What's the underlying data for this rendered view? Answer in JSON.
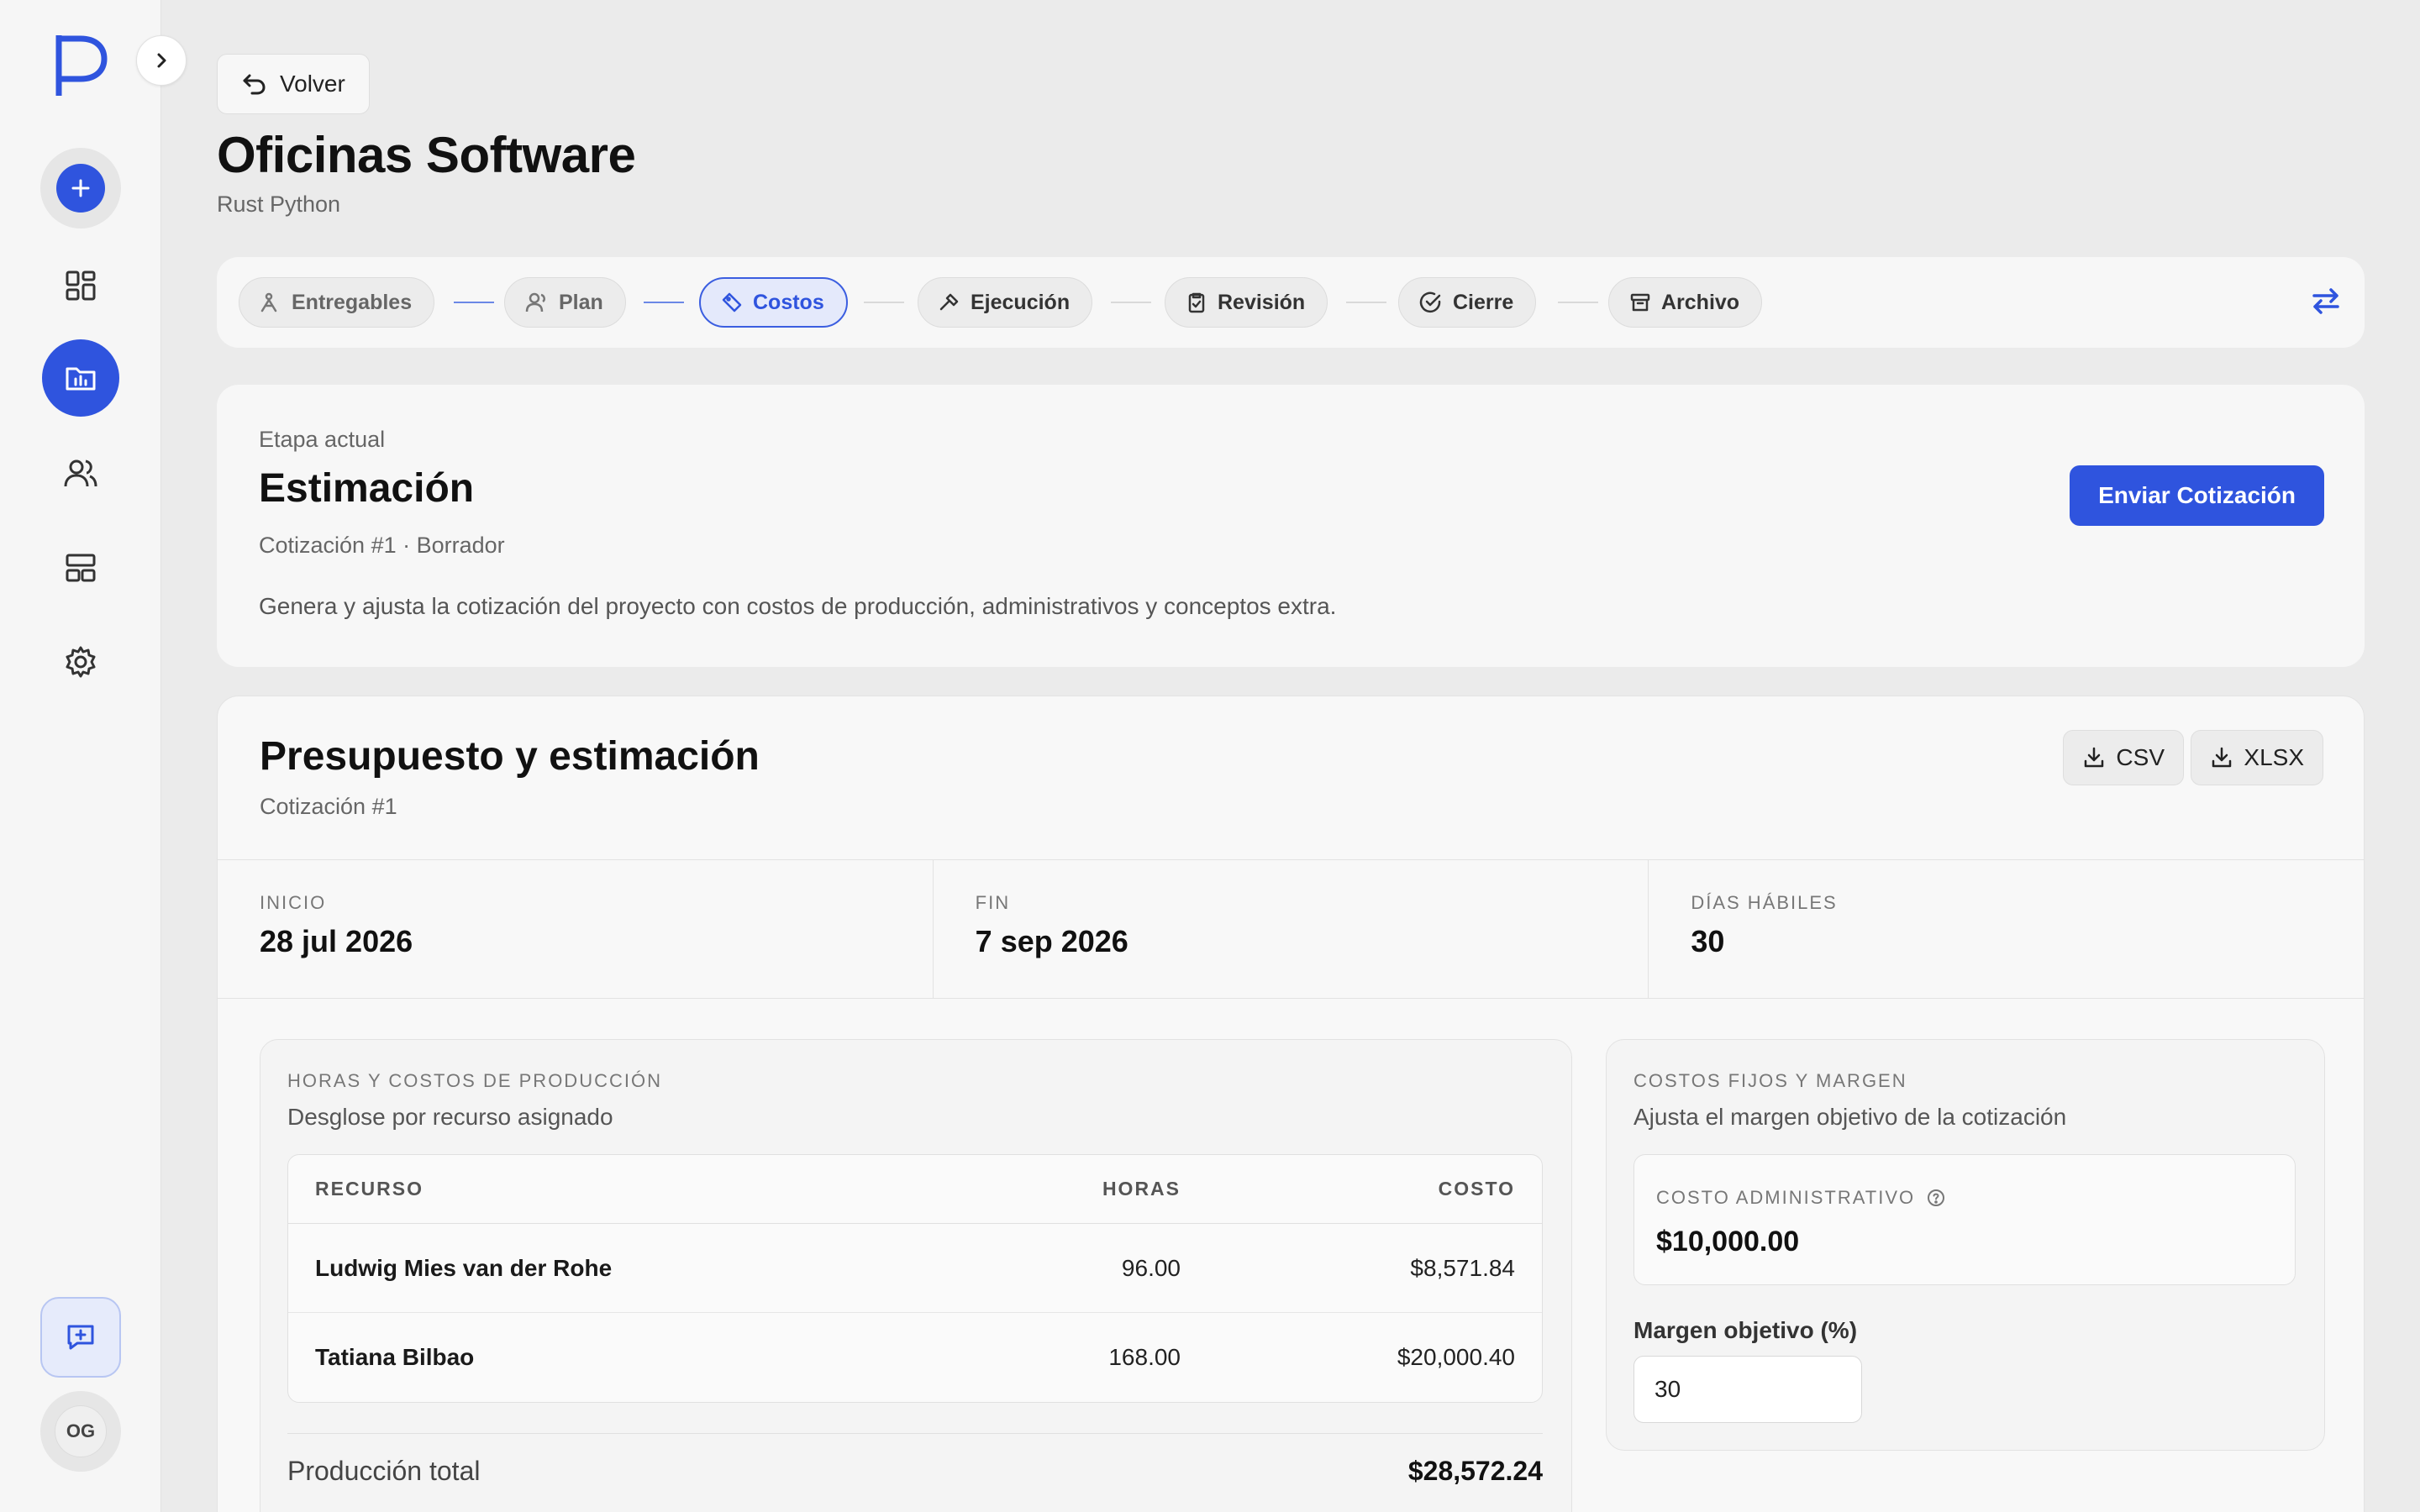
{
  "sidebar": {
    "logo_letter": "P",
    "avatar_initials": "OG",
    "icons": [
      "add-icon",
      "dashboard-icon",
      "projects-icon",
      "users-icon",
      "layout-icon",
      "settings-icon",
      "chat-icon"
    ],
    "accent": "#2f54de"
  },
  "header": {
    "back_label": "Volver",
    "title": "Oficinas Software",
    "subtitle": "Rust Python"
  },
  "stepper": {
    "steps": [
      {
        "label": "Entregables",
        "state": "done"
      },
      {
        "label": "Plan",
        "state": "done"
      },
      {
        "label": "Costos",
        "state": "active"
      },
      {
        "label": "Ejecución",
        "state": "todo"
      },
      {
        "label": "Revisión",
        "state": "todo"
      },
      {
        "label": "Cierre",
        "state": "todo"
      },
      {
        "label": "Archivo",
        "state": "todo"
      }
    ]
  },
  "stage": {
    "label": "Etapa actual",
    "title": "Estimación",
    "meta": "Cotización #1 · Borrador",
    "description": "Genera y ajusta la cotización del proyecto con costos de producción, administrativos y conceptos extra.",
    "send_label": "Enviar Cotización"
  },
  "budget": {
    "title": "Presupuesto y estimación",
    "subtitle": "Cotización #1",
    "export_csv": "CSV",
    "export_xlsx": "XLSX",
    "dates": [
      {
        "label": "INICIO",
        "value": "28 jul 2026"
      },
      {
        "label": "FIN",
        "value": "7 sep 2026"
      },
      {
        "label": "DÍAS HÁBILES",
        "value": "30"
      }
    ],
    "production": {
      "kicker": "HORAS Y COSTOS DE PRODUCCIÓN",
      "subtitle": "Desglose por recurso asignado",
      "columns": {
        "resource": "RECURSO",
        "hours": "HORAS",
        "cost": "COSTO"
      },
      "rows": [
        {
          "resource": "Ludwig Mies van der Rohe",
          "hours": "96.00",
          "cost": "$8,571.84"
        },
        {
          "resource": "Tatiana Bilbao",
          "hours": "168.00",
          "cost": "$20,000.40"
        }
      ],
      "total_label": "Producción total",
      "total_value": "$28,572.24"
    },
    "fixed": {
      "kicker": "COSTOS FIJOS Y MARGEN",
      "subtitle": "Ajusta el margen objetivo de la cotización",
      "admin_label": "COSTO ADMINISTRATIVO",
      "admin_value": "$10,000.00",
      "margin_label": "Margen objetivo (%)",
      "margin_value": "30"
    }
  }
}
